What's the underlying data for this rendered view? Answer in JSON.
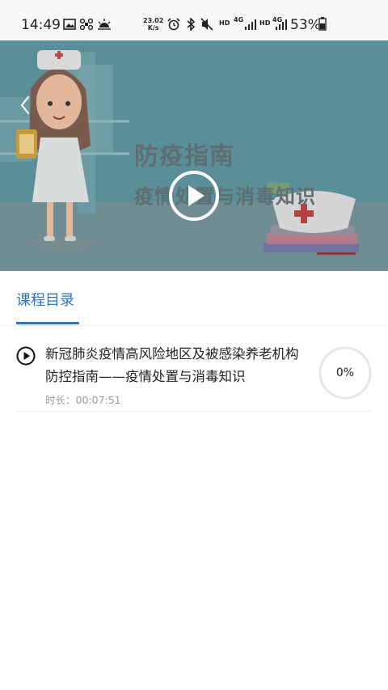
{
  "status_bar": {
    "time": "14:49",
    "speed_value": "23.02",
    "speed_unit": "K/s",
    "hd1": "HD",
    "net1": "4G",
    "hd2": "HD",
    "net2": "4G",
    "battery": "53%"
  },
  "video": {
    "banner_title": "防疫指南",
    "banner_subtitle": "疫情处置与消毒知识"
  },
  "tabs": {
    "active_label": "课程目录"
  },
  "lessons": [
    {
      "title": "新冠肺炎疫情高风险地区及被感染养老机构防控指南——疫情处置与消毒知识",
      "duration": "时长：00:07:51",
      "progress_text": "0%",
      "progress": 0
    }
  ],
  "colors": {
    "accent": "#2d73c7",
    "banner_bg": "#1f8896"
  }
}
